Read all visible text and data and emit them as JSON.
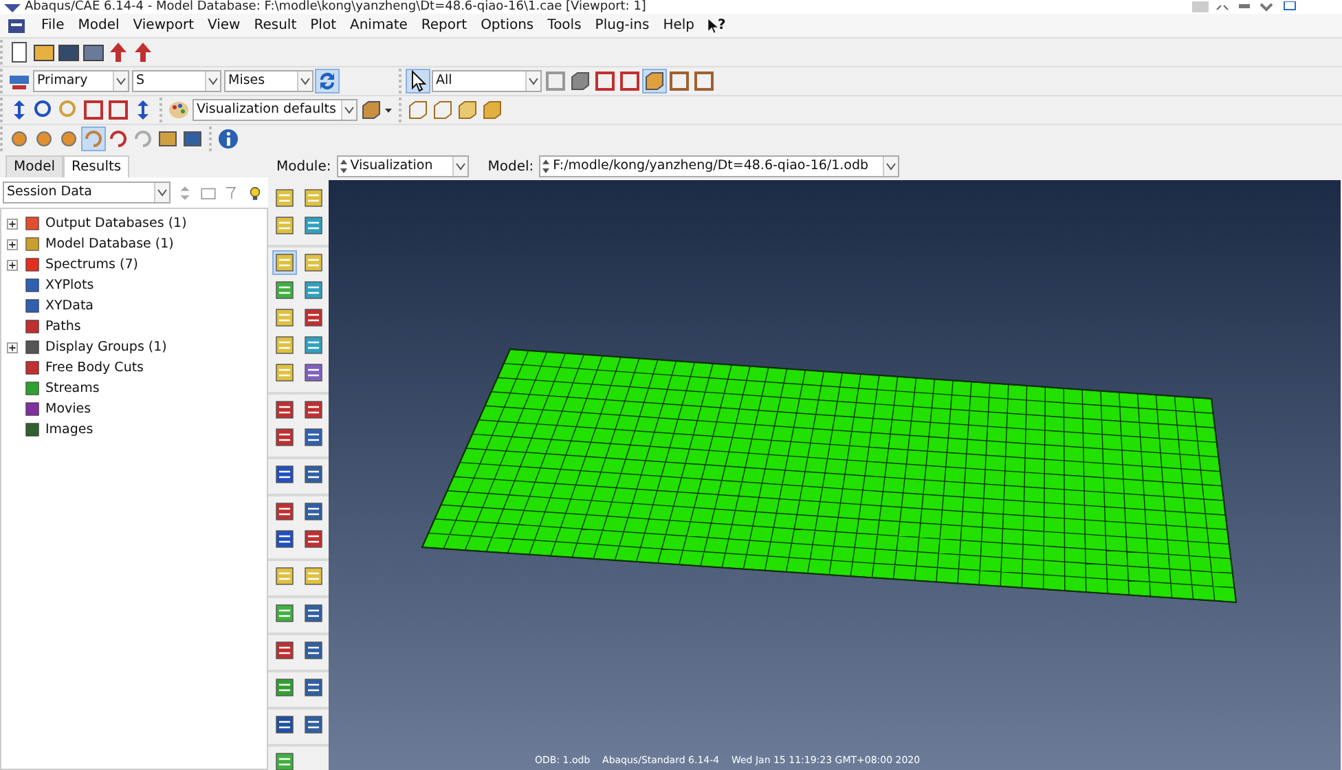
{
  "window": {
    "title": "Abaqus/CAE 6.14-4 - Model Database: F:\\modle\\kong\\yanzheng\\Dt=48.6-qiao-16\\1.cae [Viewport: 1]"
  },
  "menu": [
    "File",
    "Model",
    "Viewport",
    "View",
    "Result",
    "Plot",
    "Animate",
    "Report",
    "Options",
    "Tools",
    "Plug-ins",
    "Help"
  ],
  "whats_this": "?",
  "toolbar": {
    "step": "Primary",
    "variable": "S",
    "invariant": "Mises",
    "selection": "All",
    "render_style": "Visualization defaults"
  },
  "tabs": [
    {
      "label": "Model",
      "selected": false
    },
    {
      "label": "Results",
      "selected": true
    }
  ],
  "context": {
    "module_label": "Module:",
    "module": "Visualization",
    "model_label": "Model:",
    "model": "F:/modle/kong/yanzheng/Dt=48.6-qiao-16/1.odb"
  },
  "session": "Session Data",
  "tree": [
    {
      "label": "Output Databases (1)",
      "kind": "expandable"
    },
    {
      "label": "Model Database (1)",
      "kind": "expandable"
    },
    {
      "label": "Spectrums (7)",
      "kind": "expandable"
    },
    {
      "label": "XYPlots",
      "kind": "leaf"
    },
    {
      "label": "XYData",
      "kind": "leaf"
    },
    {
      "label": "Paths",
      "kind": "leaf"
    },
    {
      "label": "Display Groups (1)",
      "kind": "expandable"
    },
    {
      "label": "Free Body Cuts",
      "kind": "leaf"
    },
    {
      "label": "Streams",
      "kind": "leaf"
    },
    {
      "label": "Movies",
      "kind": "leaf"
    },
    {
      "label": "Images",
      "kind": "leaf"
    }
  ],
  "viewport": {
    "status": "ODB: 1.odb    Abaqus/Standard 6.14-4    Wed Jan 15 11:19:23 GMT+08:00 2020"
  }
}
